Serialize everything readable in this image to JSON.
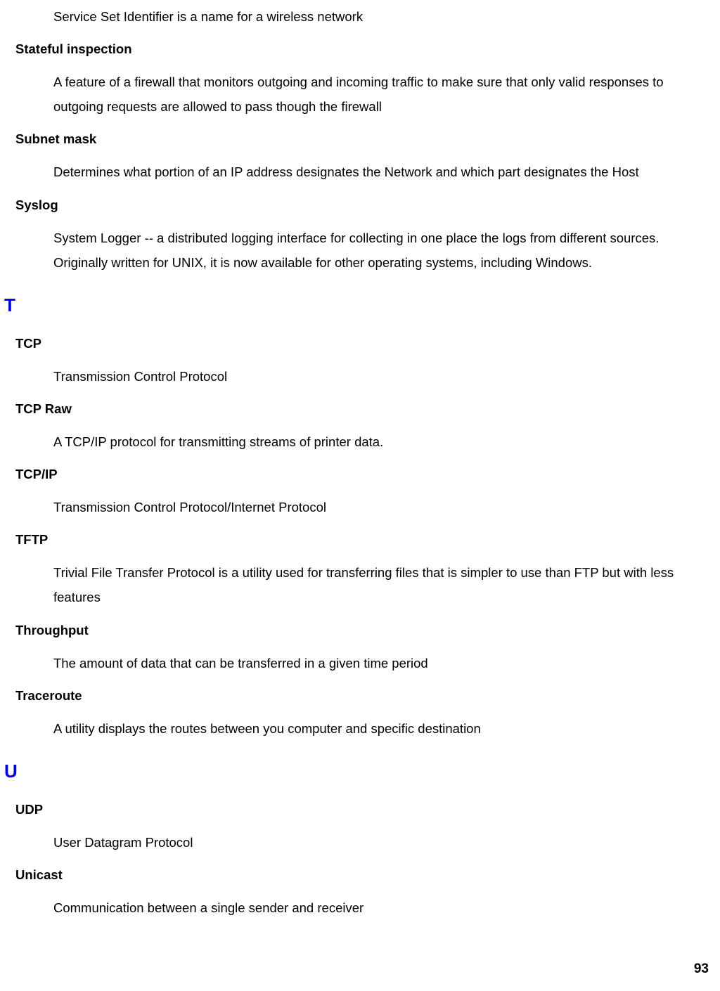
{
  "entries_before_t": [
    {
      "definition": "Service Set Identifier is a name for a wireless network"
    },
    {
      "term": "Stateful inspection",
      "definition": "A feature of a firewall that monitors outgoing and incoming traffic to make sure that only valid responses to outgoing requests are allowed to pass though the firewall"
    },
    {
      "term": "Subnet mask",
      "definition": "Determines what portion of an IP address designates the Network and which part designates the Host"
    },
    {
      "term": "Syslog",
      "definition": "System Logger -- a distributed logging interface for collecting in one place the logs from different sources. Originally written for UNIX, it is now available for other operating systems, including Windows."
    }
  ],
  "section_t": "T",
  "entries_t": [
    {
      "term": "TCP",
      "definition": "Transmission Control Protocol"
    },
    {
      "term": "TCP Raw",
      "definition": "A TCP/IP protocol for transmitting streams of printer data."
    },
    {
      "term": "TCP/IP",
      "definition": "Transmission Control Protocol/Internet Protocol"
    },
    {
      "term": "TFTP",
      "definition": "Trivial File Transfer Protocol is a utility used for transferring files that is simpler to use than FTP but with less features"
    },
    {
      "term": "Throughput",
      "definition": "The amount of data that can be transferred in a given time period"
    },
    {
      "term": "Traceroute",
      "definition": "A utility displays the routes between you computer and specific destination"
    }
  ],
  "section_u": "U",
  "entries_u": [
    {
      "term": "UDP",
      "definition": "User Datagram Protocol"
    },
    {
      "term": "Unicast",
      "definition": "Communication between a single sender and receiver"
    }
  ],
  "page_number": "93"
}
